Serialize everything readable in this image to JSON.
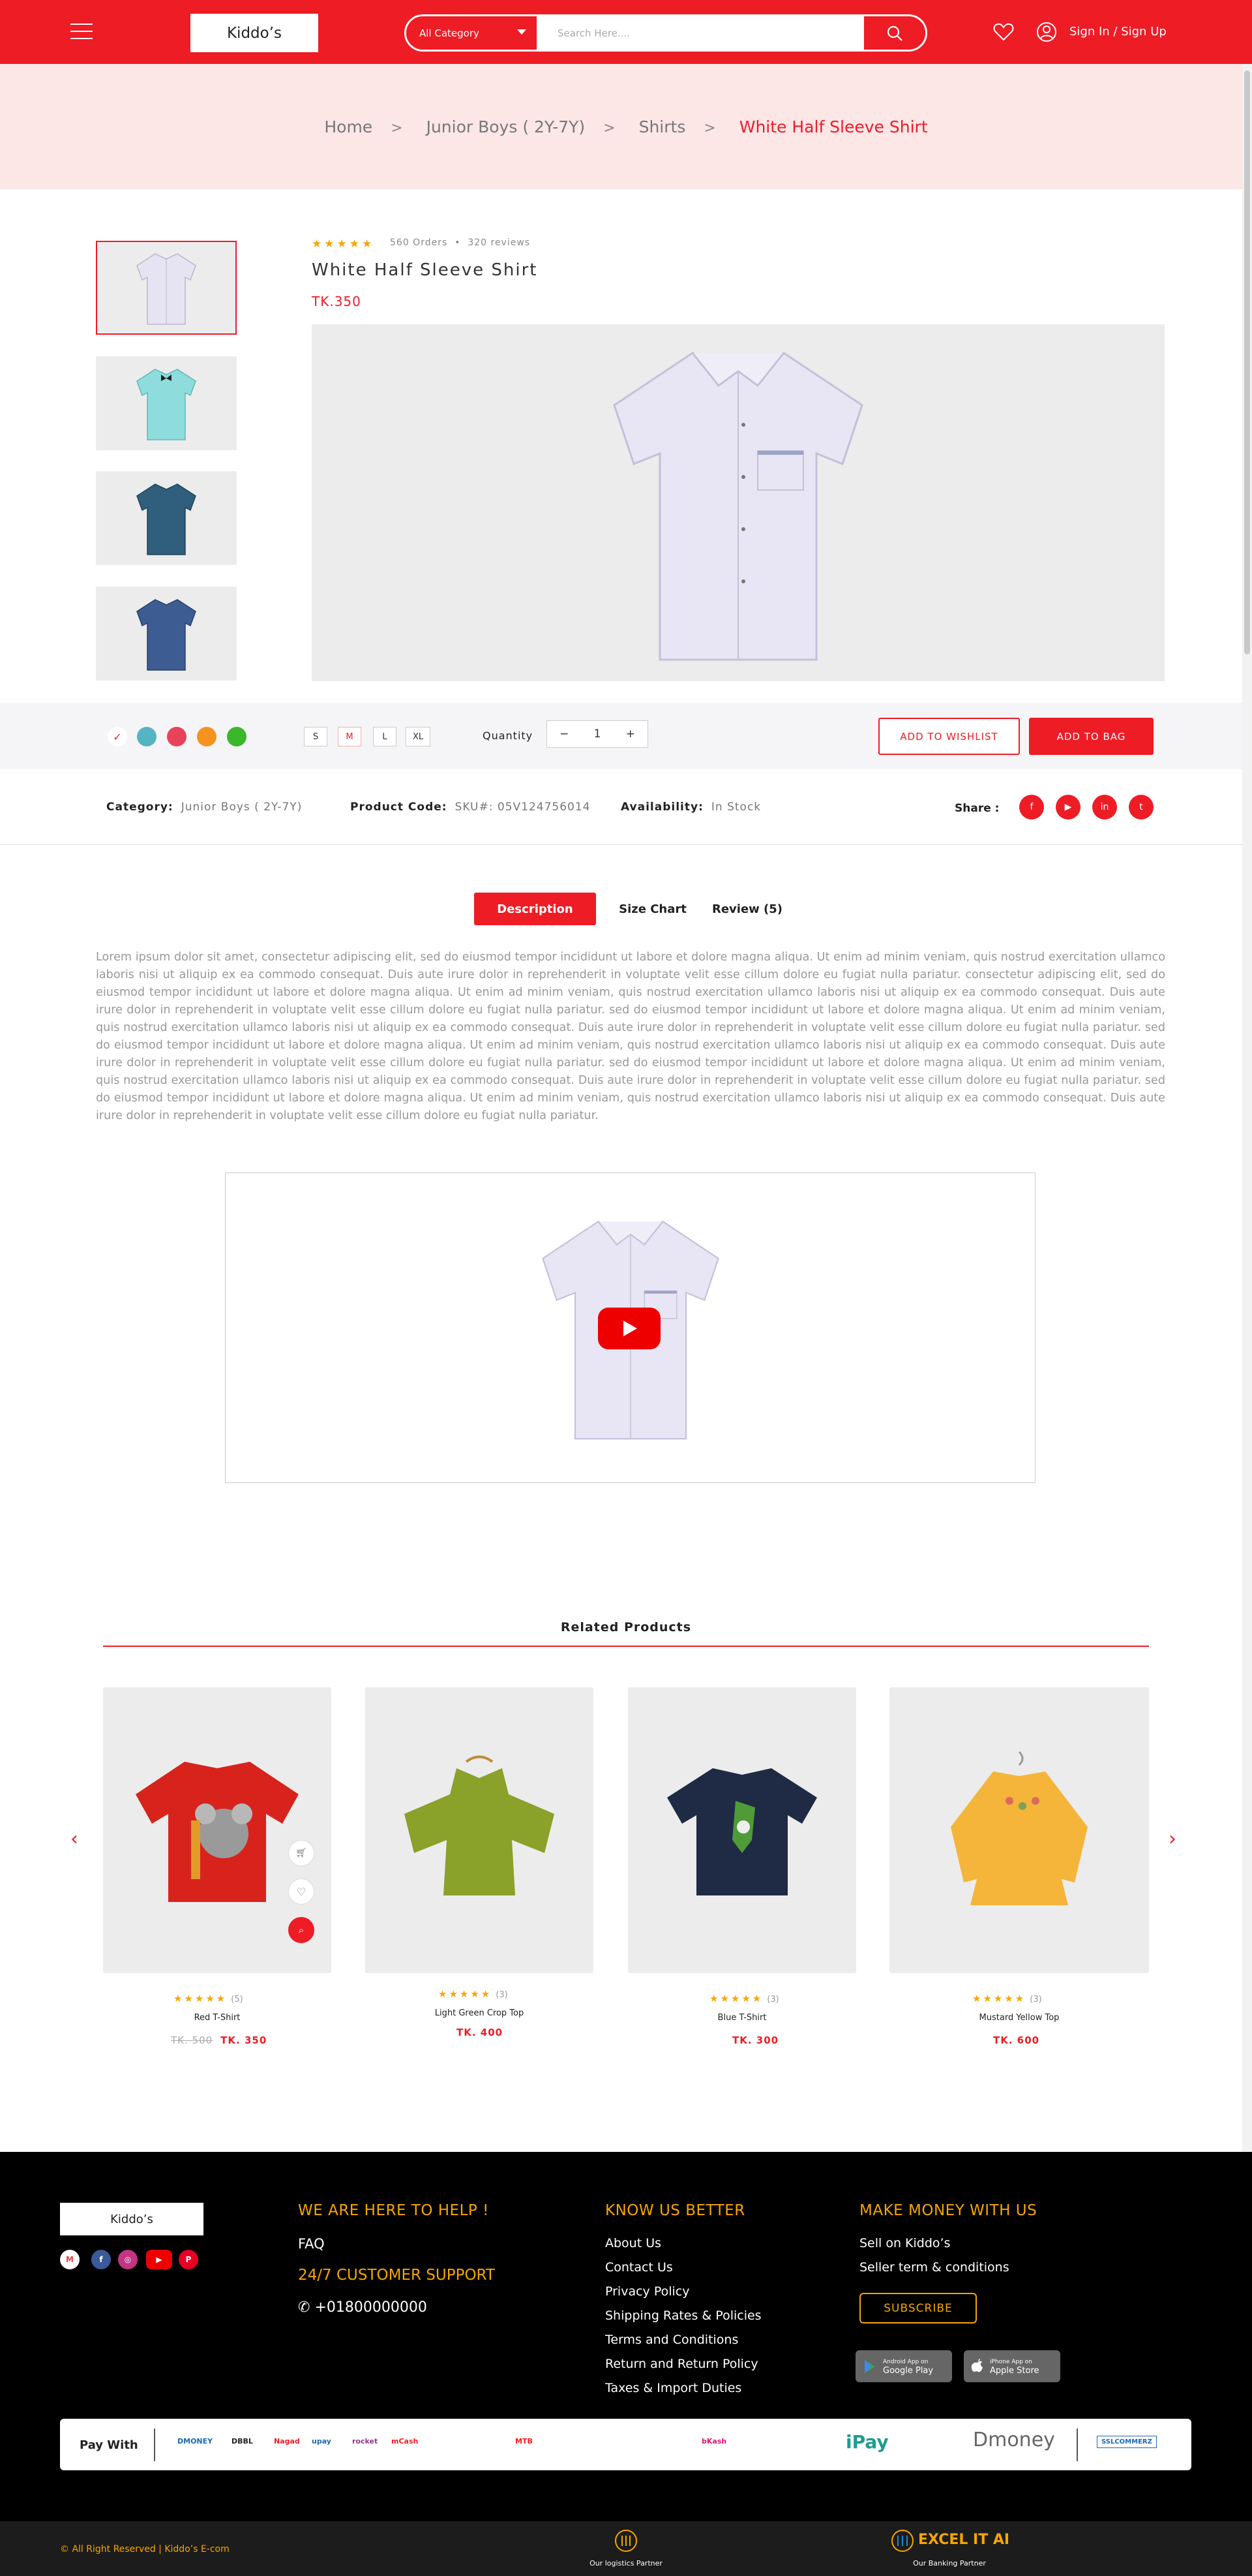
{
  "header": {
    "logo": "Kiddo’s",
    "category_select": "All Category",
    "search_placeholder": "Search Here....",
    "signin": "Sign In / Sign Up"
  },
  "breadcrumb": [
    "Home",
    "Junior Boys ( 2Y-7Y)",
    "Shirts",
    "White Half Sleeve Shirt"
  ],
  "product": {
    "stars": "★★★★★",
    "orders": "560 Orders",
    "reviews": "320 reviews",
    "title": "White Half Sleeve Shirt",
    "price": "TK.350",
    "colors": [
      "#ffffff",
      "#54b4c4",
      "#e8435a",
      "#f6921e",
      "#3ab72b"
    ],
    "sizes": [
      "S",
      "M",
      "L",
      "XL"
    ],
    "selected_size": "M",
    "quantity_label": "Quantity",
    "quantity": "1",
    "minus": "−",
    "plus": "+",
    "wishlist_btn": "ADD TO WISHLIST",
    "bag_btn": "ADD TO BAG",
    "category_label": "Category:",
    "category_value": "Junior Boys ( 2Y-7Y)",
    "code_label": "Product Code:",
    "code_value": "SKU#: 05V124756014",
    "availability_label": "Availability:",
    "availability_value": "In Stock",
    "share_label": "Share :"
  },
  "tabs": [
    "Description",
    "Size Chart",
    "Review (5)"
  ],
  "description": "Lorem ipsum dolor sit amet, consectetur adipiscing elit, sed do eiusmod tempor incididunt ut labore et dolore magna aliqua. Ut enim ad minim veniam, quis nostrud exercitation ullamco laboris nisi ut aliquip ex ea commodo consequat. Duis aute irure dolor in reprehenderit in voluptate velit esse cillum dolore eu fugiat nulla pariatur. consectetur adipiscing elit, sed do eiusmod tempor incididunt ut labore et dolore magna aliqua. Ut enim ad minim veniam, quis nostrud exercitation ullamco laboris nisi ut aliquip ex ea commodo consequat. Duis aute irure dolor in reprehenderit in voluptate velit esse cillum dolore eu fugiat nulla pariatur. sed do eiusmod tempor incididunt ut labore et dolore magna aliqua. Ut enim ad minim veniam, quis nostrud exercitation ullamco laboris nisi ut aliquip ex ea commodo consequat. Duis aute irure dolor in reprehenderit in voluptate velit esse cillum dolore eu fugiat nulla pariatur. sed do eiusmod tempor incididunt ut labore et dolore magna aliqua. Ut enim ad minim veniam, quis nostrud exercitation ullamco laboris nisi ut aliquip ex ea commodo consequat. Duis aute irure dolor in reprehenderit in voluptate velit esse cillum dolore eu fugiat nulla pariatur. sed do eiusmod tempor incididunt ut labore et dolore magna aliqua. Ut enim ad minim veniam, quis nostrud exercitation ullamco laboris nisi ut aliquip ex ea commodo consequat. Duis aute irure dolor in reprehenderit in voluptate velit esse cillum dolore eu fugiat nulla pariatur. sed do eiusmod tempor incididunt ut labore et dolore magna aliqua. Ut enim ad minim veniam, quis nostrud exercitation ullamco laboris nisi ut aliquip ex ea commodo consequat. Duis aute irure dolor in reprehenderit in voluptate velit esse cillum dolore eu fugiat nulla pariatur.",
  "related": {
    "title": "Related Products",
    "items": [
      {
        "name": "Red T-Shirt",
        "stars": "★★★★★",
        "count": "(5)",
        "old_price": "TK. 500",
        "price": "TK. 350"
      },
      {
        "name": "Light Green Crop Top",
        "stars": "★★★★★",
        "count": "(3)",
        "price": "TK. 400"
      },
      {
        "name": "Blue T-Shirt",
        "stars": "★★★★★",
        "count": "(3)",
        "price": "TK. 300"
      },
      {
        "name": "Mustard Yellow Top",
        "stars": "★★★★★",
        "count": "(3)",
        "price": "TK. 600"
      }
    ]
  },
  "footer": {
    "logo": "Kiddo’s",
    "help_heading": "WE ARE HERE TO HELP !",
    "faq": "FAQ",
    "support": "24/7 CUSTOMER SUPPORT",
    "phone": "+01800000000",
    "know_heading": "KNOW US BETTER",
    "know_links": [
      "About Us",
      "Contact Us",
      "Privacy Policy",
      "Shipping Rates & Policies",
      "Terms and Conditions",
      "Return and Return Policy",
      "Taxes & Import Duties"
    ],
    "money_heading": "MAKE MONEY WITH US",
    "money_links": [
      "Sell on Kiddo’s",
      "Seller term & conditions"
    ],
    "subscribe": "SUBSCRIBE",
    "google_small": "Android App on",
    "google_big": "Google Play",
    "apple_small": "iPhone App on",
    "apple_big": "Apple Store",
    "pay_with": "Pay With",
    "pay_logos": [
      "DMONEY",
      "DBBL",
      "Nagad",
      "upay",
      "rocket",
      "mCash",
      "MTB",
      "bKash",
      "iPay",
      "Dmoney",
      "SSLCOMMERZ"
    ],
    "copyright": "© All Right Reserved | Kiddo’s E-com",
    "logistics_partner": "Our logistics Partner",
    "banking_name": "EXCEL IT AI",
    "banking_partner": "Our Banking Partner"
  }
}
